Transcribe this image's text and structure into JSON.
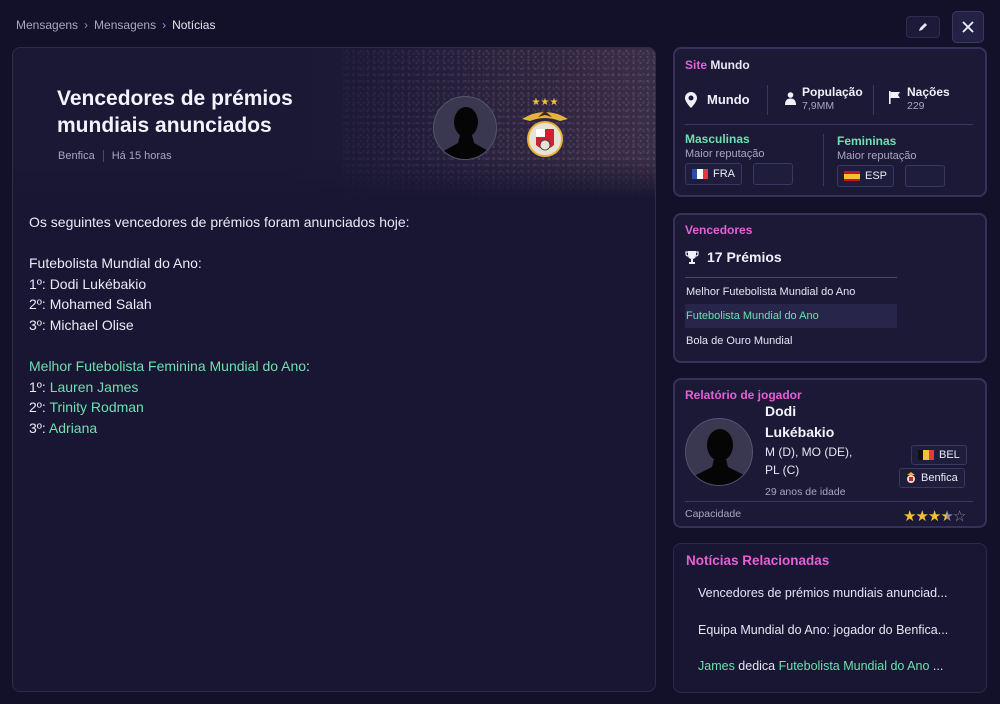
{
  "breadcrumb": {
    "items": [
      "Mensagens",
      "Mensagens",
      "Notícias"
    ]
  },
  "article": {
    "title": "Vencedores de prémios mundiais anunciados",
    "source": "Benfica",
    "time": "Há 15 horas",
    "lines": [
      {
        "text": "Os seguintes vencedores de prémios foram anunciados hoje:",
        "type": "plain"
      },
      {
        "text": "",
        "type": "plain"
      },
      {
        "text": "Futebolista Mundial do Ano:",
        "type": "plain"
      },
      {
        "prefix": "1º: ",
        "text": "Dodi Lukébakio",
        "type": "plain"
      },
      {
        "prefix": "2º: ",
        "text": "Mohamed Salah",
        "type": "plain"
      },
      {
        "prefix": "3º: ",
        "text": "Michael Olise",
        "type": "plain"
      },
      {
        "text": "",
        "type": "plain"
      },
      {
        "text": "Melhor Futebolista Feminina Mundial do Ano",
        "suffix": ":",
        "type": "link"
      },
      {
        "prefix": "1º: ",
        "text": "Lauren James",
        "type": "link"
      },
      {
        "prefix": "2º: ",
        "text": "Trinity Rodman",
        "type": "link"
      },
      {
        "prefix": "3º: ",
        "text": "Adriana",
        "type": "link"
      }
    ]
  },
  "site": {
    "title_a": "Site",
    "title_b": "Mundo",
    "location": "Mundo",
    "population_label": "População",
    "population_value": "7,9MM",
    "nations_label": "Nações",
    "nations_value": "229",
    "male_label": "Masculinas",
    "female_label": "Femininas",
    "rep_label": "Maior reputação",
    "male_country": "FRA",
    "female_country": "ESP"
  },
  "winners": {
    "title": "Vencedores",
    "count_label": "17 Prémios",
    "items": [
      "Melhor Futebolista Mundial do Ano",
      "Futebolista Mundial do Ano",
      "Bola de Ouro Mundial"
    ],
    "selected_index": 1
  },
  "player_report": {
    "title": "Relatório de jogador",
    "first_name": "Dodi",
    "last_name": "Lukébakio",
    "positions_1": "M (D), MO (DE),",
    "positions_2": "PL (C)",
    "age": "29 anos de idade",
    "nation": "BEL",
    "club": "Benfica",
    "ability_label": "Capacidade",
    "ability_stars": 3.5,
    "ability_max": 5
  },
  "related": {
    "title": "Notícias Relacionadas",
    "items": [
      {
        "text": "Vencedores de prémios mundiais anunciad..."
      },
      {
        "text": "Equipa Mundial do Ano: jogador do Benfica..."
      },
      {
        "parts": [
          {
            "t": "James",
            "g": true
          },
          {
            "t": " dedica ",
            "g": false
          },
          {
            "t": "Futebolista Mundial do Ano",
            "g": true
          },
          {
            "t": " ...",
            "g": false
          }
        ]
      }
    ]
  },
  "colors": {
    "accent_pink": "#e85fd6",
    "accent_green": "#6fe0b0",
    "star": "#f2c230",
    "bg": "#13112a"
  },
  "icons": [
    "chevron-right-icon",
    "pencil-icon",
    "close-icon",
    "location-pin-icon",
    "person-icon",
    "flag-icon",
    "trophy-icon",
    "star-icon"
  ]
}
